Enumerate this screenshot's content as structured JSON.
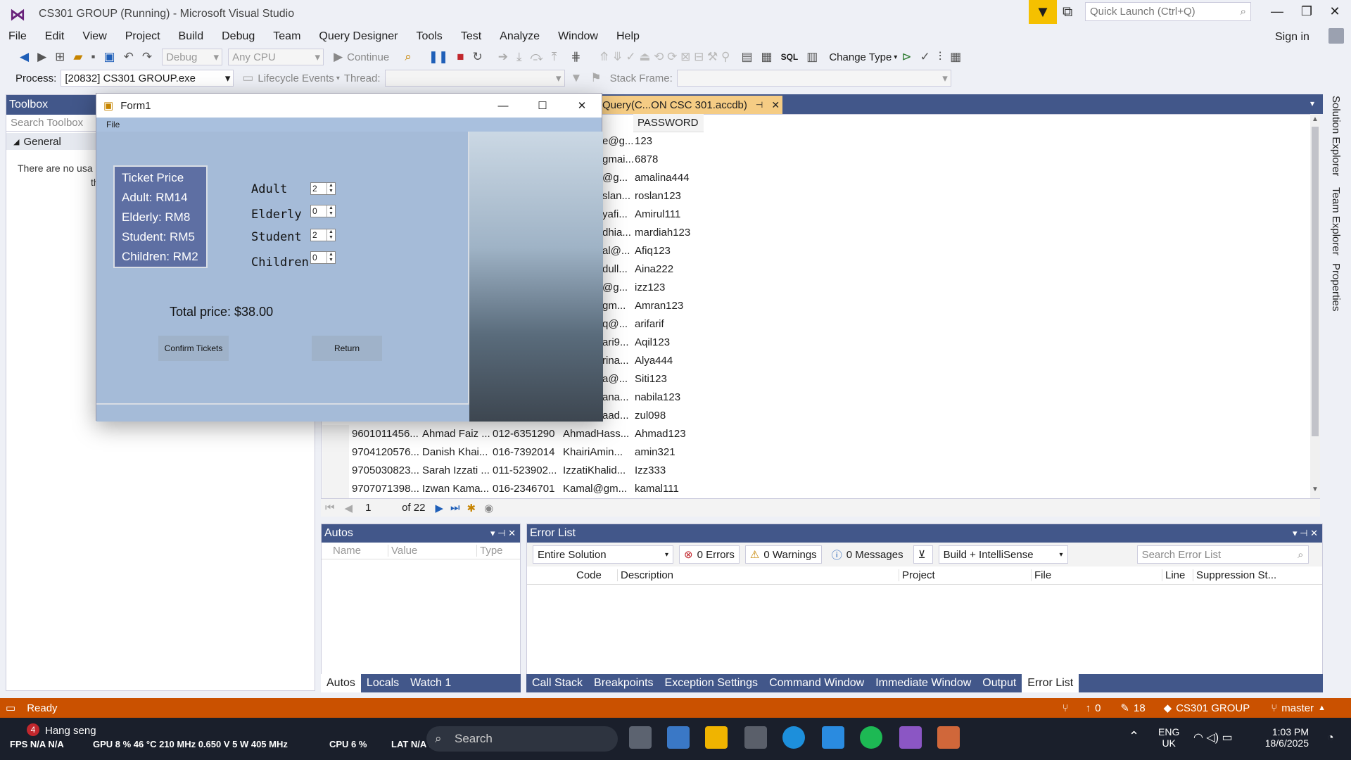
{
  "titlebar": {
    "title": "CS301 GROUP (Running) - Microsoft Visual Studio",
    "quick_launch": "Quick Launch (Ctrl+Q)",
    "sign_in": "Sign in"
  },
  "menu": [
    "File",
    "Edit",
    "View",
    "Project",
    "Build",
    "Debug",
    "Team",
    "Query Designer",
    "Tools",
    "Test",
    "Analyze",
    "Window",
    "Help"
  ],
  "toolbar": {
    "config": "Debug",
    "platform": "Any CPU",
    "continue": "Continue",
    "change_type": "Change Type",
    "sql": "SQL"
  },
  "toolbar2": {
    "process_label": "Process:",
    "process": "[20832] CS301 GROUP.exe",
    "lifecycle": "Lifecycle Events",
    "thread_label": "Thread:",
    "stack_label": "Stack Frame:"
  },
  "toolbox": {
    "title": "Toolbox",
    "search_placeholder": "Search Toolbox",
    "group": "General",
    "message_l1": "There are no usa",
    "message_l2": "thi"
  },
  "doc_tab": "Query(C...ON  CSC 301.accdb)",
  "grid": {
    "password_header": "PASSWORD",
    "partial_rows": [
      [
        "e@g...",
        "123"
      ],
      [
        "gmai...",
        "6878"
      ],
      [
        "@g...",
        "amalina444"
      ],
      [
        "slan...",
        "roslan123"
      ],
      [
        "yafi...",
        "Amirul111"
      ],
      [
        "dhia...",
        "mardiah123"
      ],
      [
        "al@...",
        "Afiq123"
      ],
      [
        "dull...",
        "Aina222"
      ],
      [
        "@g...",
        "izz123"
      ],
      [
        "gm...",
        "Amran123"
      ],
      [
        "q@...",
        "arifarif"
      ],
      [
        "ari9...",
        "Aqil123"
      ],
      [
        "rina...",
        "Alya444"
      ],
      [
        "a@...",
        "Siti123"
      ],
      [
        "ana...",
        "nabila123"
      ],
      [
        "aad...",
        "zul098"
      ]
    ],
    "full_rows": [
      [
        "9601011456...",
        "Ahmad Faiz ...",
        "012-6351290",
        "AhmadHass...",
        "Ahmad123"
      ],
      [
        "9704120576...",
        "Danish Khai...",
        "016-7392014",
        "KhairiAmin...",
        "amin321"
      ],
      [
        "9705030823...",
        "Sarah Izzati ...",
        "011-523902...",
        "IzzatiKhalid...",
        "Izz333"
      ],
      [
        "9707071398...",
        "Izwan Kama...",
        "016-2346701",
        "Kamal@gm...",
        "kamal111"
      ]
    ],
    "nav_page": "1",
    "nav_of": "of 22"
  },
  "sidetabs": [
    "Solution Explorer",
    "Team Explorer",
    "Properties"
  ],
  "autos": {
    "title": "Autos",
    "cols": [
      "Name",
      "Value",
      "Type"
    ],
    "tabs": [
      "Autos",
      "Locals",
      "Watch 1"
    ]
  },
  "errors": {
    "title": "Error List",
    "scope": "Entire Solution",
    "errors": "0 Errors",
    "warnings": "0 Warnings",
    "messages": "0 Messages",
    "build": "Build + IntelliSense",
    "search": "Search Error List",
    "cols": [
      "Code",
      "Description",
      "Project",
      "File",
      "Line",
      "Suppression St..."
    ],
    "tabs": [
      "Call Stack",
      "Breakpoints",
      "Exception Settings",
      "Command Window",
      "Immediate Window",
      "Output",
      "Error List"
    ]
  },
  "status": {
    "ready": "Ready",
    "up": "0",
    "edits": "18",
    "project": "CS301 GROUP",
    "branch": "master"
  },
  "form1": {
    "title": "Form1",
    "menu": "File",
    "price_legend": "Ticket Price",
    "prices": [
      "Adult: RM14",
      "Elderly: RM8",
      "Student: RM5",
      "Children: RM2"
    ],
    "labels": [
      "Adult",
      "Elderly",
      "Student",
      "Children"
    ],
    "values": [
      "2",
      "0",
      "2",
      "0"
    ],
    "total": "Total price: $38.00",
    "confirm": "Confirm Tickets",
    "return": "Return"
  },
  "taskbar": {
    "notif_count": "4",
    "weather": "Hang seng",
    "fps": "FPS N/A  N/A",
    "gpu": "GPU  8 %  46 °C  210 MHz  0.650 V  5 W  405 MHz",
    "cpu": "CPU  6 %",
    "lat": "LAT N/A  N/A",
    "search": "Search",
    "lang1": "ENG",
    "lang2": "UK",
    "time": "1:03 PM",
    "date": "18/6/2025"
  }
}
